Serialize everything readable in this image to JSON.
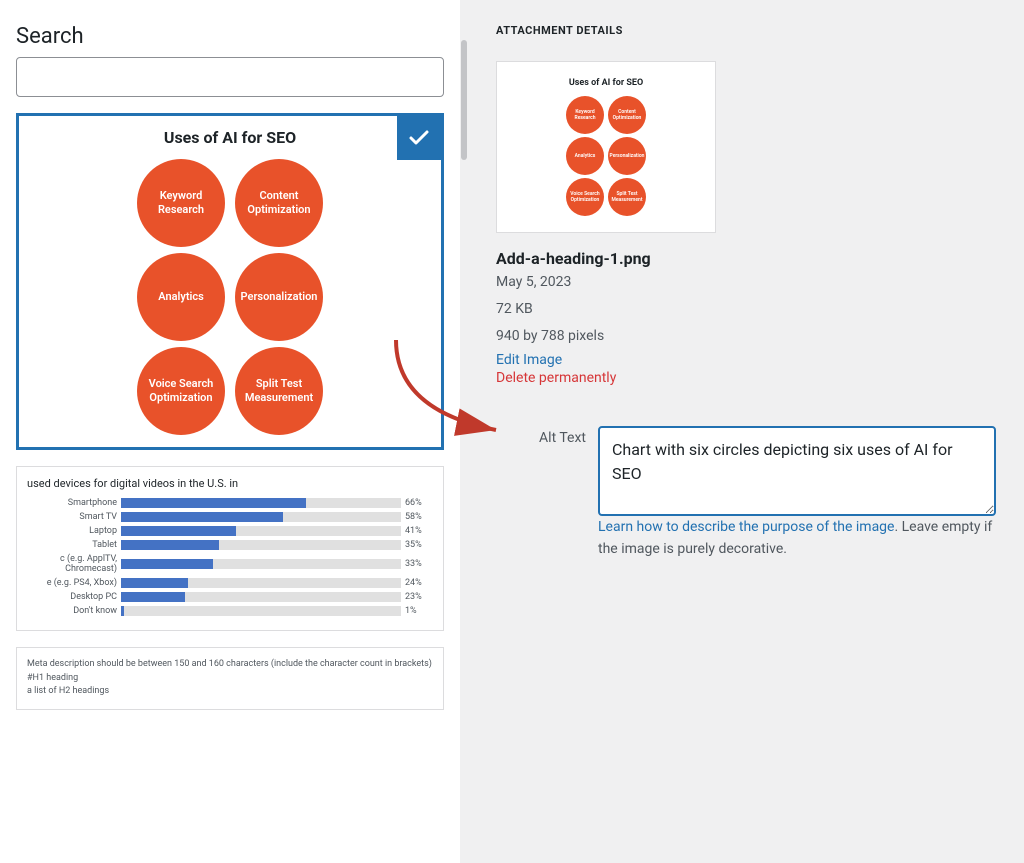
{
  "search": {
    "label": "Search",
    "placeholder": ""
  },
  "selected_image": {
    "title": "Uses of AI for SEO",
    "circles": [
      {
        "label": "Keyword\nResearch"
      },
      {
        "label": "Content\nOptimization"
      },
      {
        "label": "Analytics"
      },
      {
        "label": "Personalization"
      },
      {
        "label": "Voice Search\nOptimization"
      },
      {
        "label": "Split Test\nMeasurement"
      }
    ]
  },
  "bar_chart": {
    "title": "used devices for digital videos in the U.S. in",
    "bars": [
      {
        "label": "Smartphone",
        "pct": 66
      },
      {
        "label": "Smart TV",
        "pct": 58
      },
      {
        "label": "Laptop",
        "pct": 41
      },
      {
        "label": "Tablet",
        "pct": 35
      },
      {
        "label": "c (e.g. ApplTV, Chromecast)",
        "pct": 33
      },
      {
        "label": "e (e.g. PS4, Xbox)",
        "pct": 24
      },
      {
        "label": "Desktop PC",
        "pct": 23
      },
      {
        "label": "Don't know",
        "pct": 1
      }
    ]
  },
  "text_preview": {
    "lines": [
      "Meta description should be between 150 and 160 characters (include the character count in brackets)",
      "#H1 heading",
      "a list of H2 headings"
    ]
  },
  "attachment_details": {
    "section_title": "ATTACHMENT DETAILS",
    "file_name": "Add-a-heading-1.png",
    "date": "May 5, 2023",
    "size": "72 KB",
    "dimensions": "940 by 788 pixels",
    "edit_label": "Edit Image",
    "delete_label": "Delete permanently"
  },
  "alt_text": {
    "label": "Alt Text",
    "value": "Chart with six circles depicting six uses of AI for SEO",
    "hint_link": "Learn how to describe the purpose of the image",
    "hint_rest": ". Leave empty if the image is purely decorative."
  }
}
